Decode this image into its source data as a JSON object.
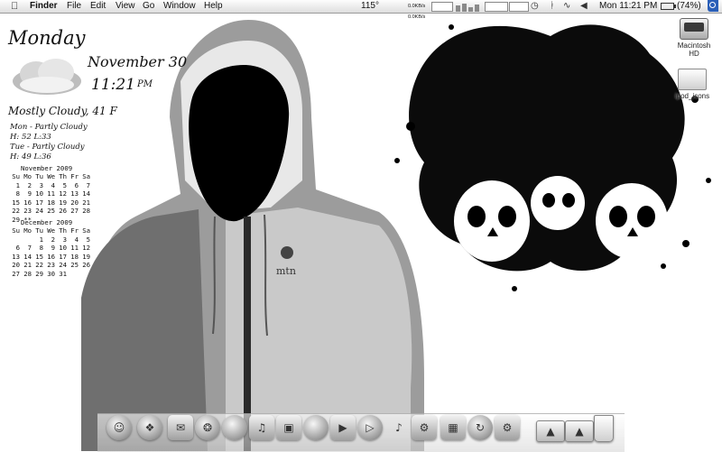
{
  "menubar": {
    "apple": "",
    "app_name": "Finder",
    "menus": [
      "File",
      "Edit",
      "View",
      "Go",
      "Window",
      "Help"
    ],
    "temperature": "115°",
    "net_up": "0.0KB/s",
    "net_down": "0.0KB/s",
    "clock": "Mon 11:21 PM",
    "battery": "(74%)",
    "icons": [
      "cpu-graph",
      "memory-bars",
      "disk-graph",
      "network-graph",
      "time-machine-icon",
      "bluetooth-icon",
      "wifi-icon",
      "volume-icon",
      "battery-icon",
      "spotlight-icon"
    ]
  },
  "widgets": {
    "day": "Monday",
    "date": "November 30",
    "time": "11:21",
    "ampm": "PM",
    "condition": "Mostly Cloudy, 41 F",
    "forecast": [
      {
        "day": "Mon - Partly Cloudy",
        "hl": "H: 52 L:33"
      },
      {
        "day": "Tue - Partly Cloudy",
        "hl": "H: 49 L:36"
      }
    ],
    "calendars": [
      {
        "title": "November 2009",
        "header": [
          "Su",
          "Mo",
          "Tu",
          "We",
          "Th",
          "Fr",
          "Sa"
        ],
        "rows": [
          [
            "1",
            "2",
            "3",
            "4",
            "5",
            "6",
            "7"
          ],
          [
            "8",
            "9",
            "10",
            "11",
            "12",
            "13",
            "14"
          ],
          [
            "15",
            "16",
            "17",
            "18",
            "19",
            "20",
            "21"
          ],
          [
            "22",
            "23",
            "24",
            "25",
            "26",
            "27",
            "28"
          ],
          [
            "29",
            "**",
            "",
            "",
            "",
            "",
            ""
          ]
        ]
      },
      {
        "title": "December 2009",
        "header": [
          "Su",
          "Mo",
          "Tu",
          "We",
          "Th",
          "Fr",
          "Sa"
        ],
        "rows": [
          [
            "",
            "",
            "1",
            "2",
            "3",
            "4",
            "5"
          ],
          [
            "6",
            "7",
            "8",
            "9",
            "10",
            "11",
            "12"
          ],
          [
            "13",
            "14",
            "15",
            "16",
            "17",
            "18",
            "19"
          ],
          [
            "20",
            "21",
            "22",
            "23",
            "24",
            "25",
            "26"
          ],
          [
            "27",
            "28",
            "29",
            "30",
            "31",
            "",
            ""
          ]
        ]
      }
    ]
  },
  "desktop": {
    "icons": [
      {
        "label": "Macintosh HD",
        "icon": "hard-drive-icon"
      },
      {
        "label": "ipod_icons",
        "icon": "folder-icon"
      }
    ],
    "wallpaper_logo": "mtn"
  },
  "dock": {
    "items": [
      "finder-icon",
      "dashboard-icon",
      "mail-icon",
      "safari-icon",
      "ical-icon",
      "itunes-icon",
      "iphoto-icon",
      "preview-icon",
      "address-book-icon",
      "quicktime-icon",
      "guitar-icon",
      "gear-icon",
      "app-icon",
      "app-icon",
      "system-preferences-icon",
      "folder-icon",
      "folder-icon",
      "trash-icon"
    ]
  }
}
